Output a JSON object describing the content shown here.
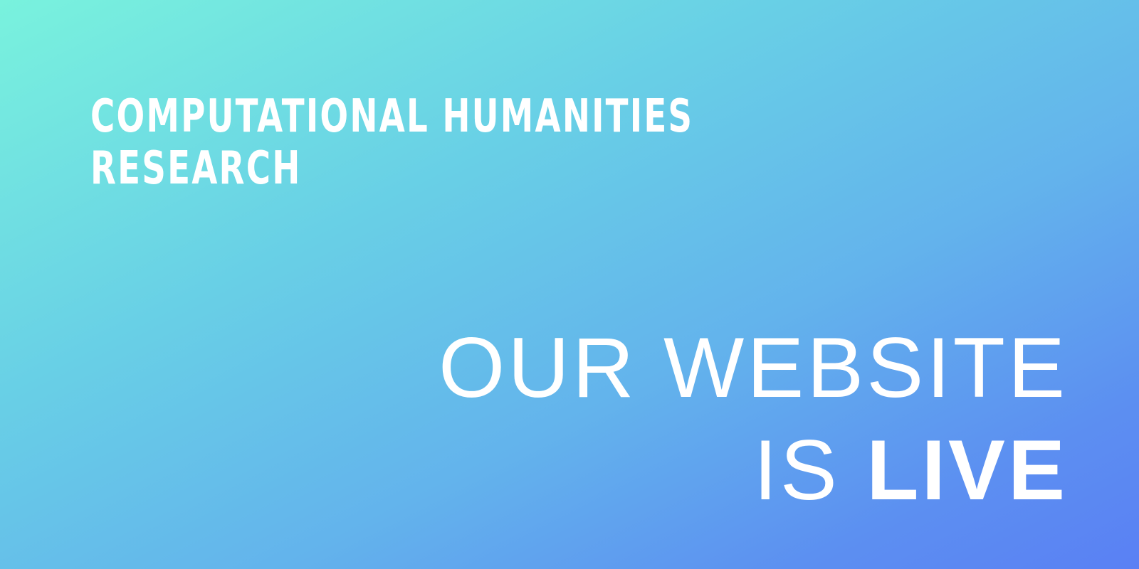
{
  "background": {
    "gradient_colors": [
      "#79f2dd",
      "#68cfe6",
      "#63b3ec",
      "#5c8ff1",
      "#5a80f4"
    ],
    "text_color": "#ffffff"
  },
  "header": {
    "line1": "COMPUTATIONAL HUMANITIES",
    "line2": "RESEARCH"
  },
  "announcement": {
    "line1": "OUR WEBSITE",
    "line2_regular": "IS",
    "line2_bold": "LIVE"
  }
}
